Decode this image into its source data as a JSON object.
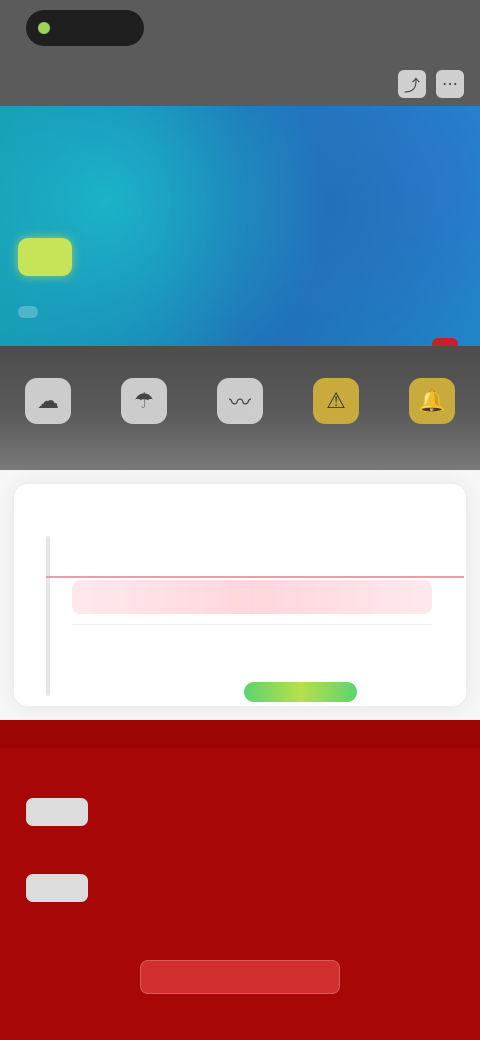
{
  "status_bar": {
    "left_badge": "",
    "right_text": ""
  },
  "top_nav": {
    "title": "",
    "icons": [
      "share-icon",
      "more-icon"
    ]
  },
  "hero": {
    "badge": "",
    "label": ""
  },
  "tabs": [
    {
      "label": "",
      "icon": "cloud-icon"
    },
    {
      "label": "",
      "icon": "rain-icon"
    },
    {
      "label": "",
      "icon": "wind-icon"
    },
    {
      "label": "",
      "icon": "alert-icon"
    },
    {
      "label": "",
      "icon": "bell-icon"
    }
  ],
  "card": {
    "time_header": "",
    "progress_fraction": 0.62
  },
  "bottom_panel": {
    "rows": [
      {
        "pill": "",
        "text": ""
      },
      {
        "pill": "",
        "text": ""
      }
    ],
    "footer_button": ""
  },
  "colors": {
    "nav_bg": "#5b5b5b",
    "hero_teal": "#1596b0",
    "hero_blue": "#1f6eb7",
    "panel_red": "#a70707",
    "accent_yellow": "#c7e35a",
    "accent_orange": "#f2a100",
    "progress_green": "#5cd36f"
  }
}
